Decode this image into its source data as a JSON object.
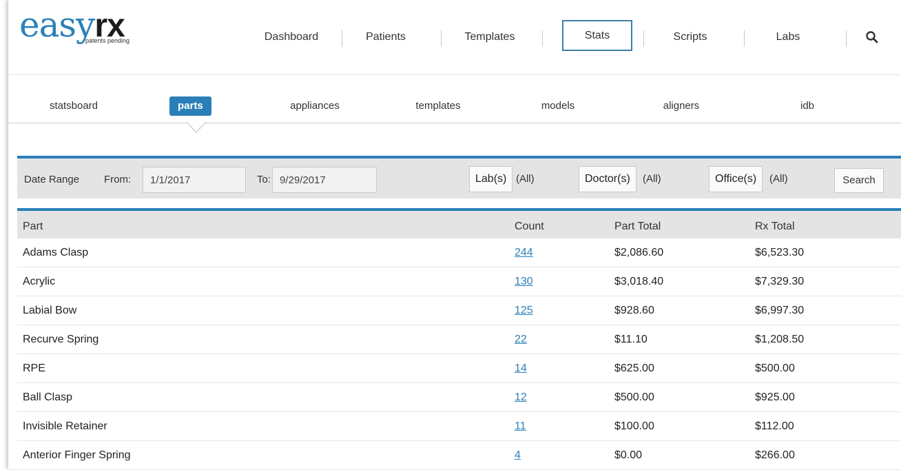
{
  "logo": {
    "easy": "easy",
    "rx": "rx",
    "tagline": "patents pending"
  },
  "nav": {
    "items": [
      {
        "label": "Dashboard"
      },
      {
        "label": "Patients"
      },
      {
        "label": "Templates"
      },
      {
        "label": "Stats",
        "active": true
      },
      {
        "label": "Scripts"
      },
      {
        "label": "Labs"
      }
    ],
    "search_icon": "search-icon"
  },
  "subnav": {
    "items": [
      {
        "label": "statsboard"
      },
      {
        "label": "parts",
        "active": true
      },
      {
        "label": "appliances"
      },
      {
        "label": "templates"
      },
      {
        "label": "models"
      },
      {
        "label": "aligners"
      },
      {
        "label": "idb"
      }
    ]
  },
  "filters": {
    "date_range_label": "Date Range",
    "from_label": "From:",
    "from_value": "1/1/2017",
    "to_label": "To:",
    "to_value": "9/29/2017",
    "labs_button": "Lab(s)",
    "labs_value": "(All)",
    "doctors_button": "Doctor(s)",
    "doctors_value": "(All)",
    "offices_button": "Office(s)",
    "offices_value": "(All)",
    "search_button": "Search"
  },
  "table": {
    "headers": {
      "part": "Part",
      "count": "Count",
      "part_total": "Part Total",
      "rx_total": "Rx Total"
    },
    "rows": [
      {
        "part": "Adams Clasp",
        "count": "244",
        "part_total": "$2,086.60",
        "rx_total": "$6,523.30"
      },
      {
        "part": "Acrylic",
        "count": "130",
        "part_total": "$3,018.40",
        "rx_total": "$7,329.30"
      },
      {
        "part": "Labial Bow",
        "count": "125",
        "part_total": "$928.60",
        "rx_total": "$6,997.30"
      },
      {
        "part": "Recurve Spring",
        "count": "22",
        "part_total": "$11.10",
        "rx_total": "$1,208.50"
      },
      {
        "part": "RPE",
        "count": "14",
        "part_total": "$625.00",
        "rx_total": "$500.00"
      },
      {
        "part": "Ball Clasp",
        "count": "12",
        "part_total": "$500.00",
        "rx_total": "$925.00"
      },
      {
        "part": "Invisible Retainer",
        "count": "11",
        "part_total": "$100.00",
        "rx_total": "$112.00"
      },
      {
        "part": "Anterior Finger Spring",
        "count": "4",
        "part_total": "$0.00",
        "rx_total": "$266.00"
      }
    ]
  },
  "colors": {
    "accent": "#2a7fb8",
    "header_bg": "#e4e4e4"
  }
}
